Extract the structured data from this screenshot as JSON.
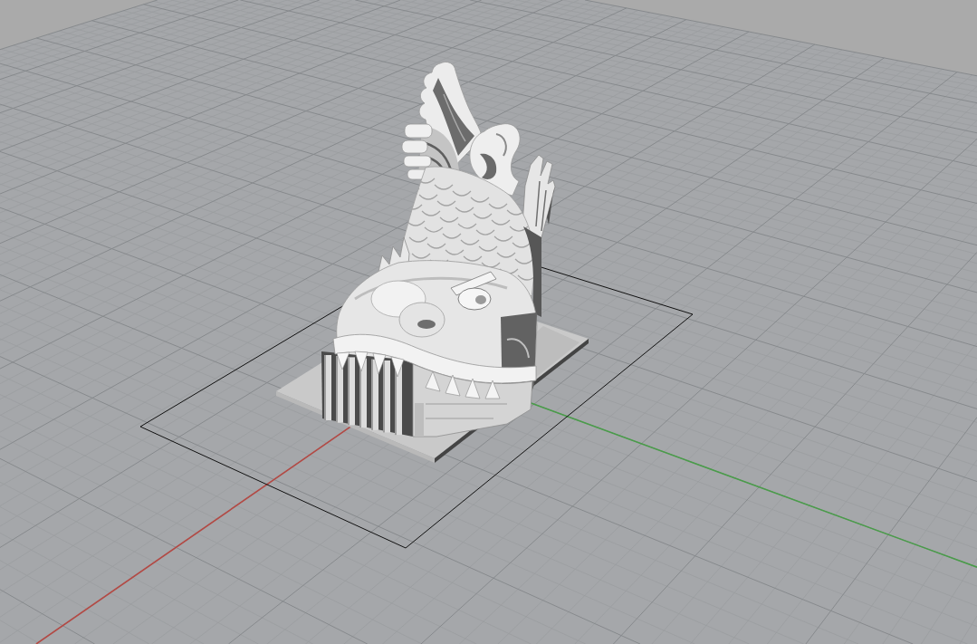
{
  "viewport": {
    "axes": [
      {
        "kind": "x",
        "color": "#b34a45"
      },
      {
        "kind": "y",
        "color": "#4a9c4a"
      }
    ]
  }
}
